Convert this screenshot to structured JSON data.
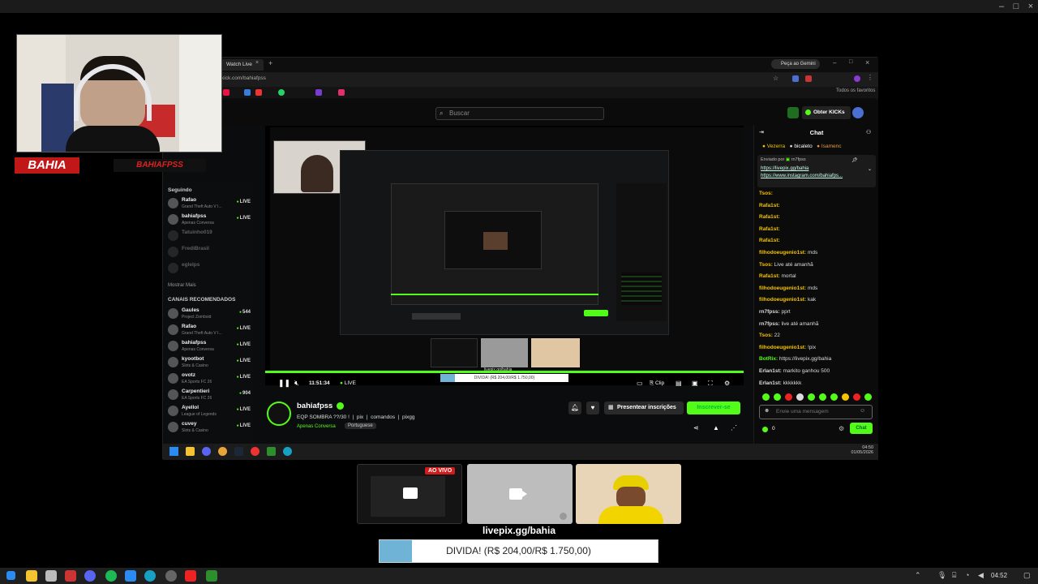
{
  "outer_window": {
    "controls": [
      "–",
      "□",
      "×"
    ]
  },
  "webcam": {
    "logo_text": "BAHIA",
    "brand_text": "BAHIAFPSS"
  },
  "browser": {
    "tab_label": "Watch Live",
    "gemini_label": "Peça ao Gemini",
    "url": "kick.com/bahiafpss",
    "bookmarks_label": "Todos os favoritos"
  },
  "kick": {
    "search_placeholder": "Buscar",
    "get_kicks": "Obter KICKs",
    "sidebar": {
      "following_header": "Seguindo",
      "following": [
        {
          "name": "Rafao",
          "sub": "Grand Theft Auto V I...",
          "status": "LIVE"
        },
        {
          "name": "bahiafpss",
          "sub": "Apenas Conversa",
          "status": "LIVE"
        },
        {
          "name": "Tatuinho019",
          "sub": "",
          "status": ""
        },
        {
          "name": "FrediBrasil",
          "sub": "",
          "status": ""
        },
        {
          "name": "eglelps",
          "sub": "",
          "status": ""
        }
      ],
      "show_more": "Mostrar Mais",
      "recommended_header": "CANAIS RECOMENDADOS",
      "recommended": [
        {
          "name": "Gaules",
          "sub": "Project Zomboid",
          "status": "544"
        },
        {
          "name": "Rafao",
          "sub": "Grand Theft Auto V I...",
          "status": "LIVE"
        },
        {
          "name": "bahiafpss",
          "sub": "Apenas Conversa",
          "status": "LIVE"
        },
        {
          "name": "kyootbot",
          "sub": "Slots & Casino",
          "status": "LIVE"
        },
        {
          "name": "ovotz",
          "sub": "EA Sports FC 26",
          "status": "LIVE"
        },
        {
          "name": "Carpentieri",
          "sub": "EA Sports FC 26",
          "status": "904"
        },
        {
          "name": "Ayellol",
          "sub": "League of Legends",
          "status": "LIVE"
        },
        {
          "name": "cuvey",
          "sub": "Slots & Casino",
          "status": "LIVE"
        }
      ]
    },
    "player": {
      "time": "11:51:34",
      "live": "LIVE",
      "clip": "Clip",
      "donation_small": "DIVIDA! (R$ 204,00/R$ 1.750,00)",
      "livepix_small": "livepix.gg/bahia"
    },
    "channel": {
      "name": "bahiafpss",
      "title_parts": [
        "EQP SOMBRA ??/30 !",
        "pix",
        "comandos",
        "pixgg"
      ],
      "category": "Apenas Conversa",
      "language": "Portuguese",
      "gift_button": "Presentear inscrições",
      "subscribe_button": "Inscrever-se"
    },
    "chat": {
      "title": "Chat",
      "top_gifters": [
        "Vezerra",
        "bicaleto",
        "Isamenc"
      ],
      "pinned_by": "Enviado por",
      "pinned_user": "rn7fpss",
      "pinned_lines": [
        "https://livepix.gg/bahia",
        "https://www.instagram.com/bahiafps..."
      ],
      "messages": [
        {
          "user": "Tsos:",
          "text": "",
          "color": "#f5c400"
        },
        {
          "user": "Rafa1st:",
          "text": "",
          "color": "#f5c400"
        },
        {
          "user": "Rafa1st:",
          "text": "",
          "color": "#f5c400"
        },
        {
          "user": "Rafa1st:",
          "text": "",
          "color": "#f5c400"
        },
        {
          "user": "Rafa1st:",
          "text": "",
          "color": "#f5c400"
        },
        {
          "user": "filhodoeugenio1st:",
          "text": "mds",
          "color": "#f5c400"
        },
        {
          "user": "Tsos:",
          "text": "Live até amanhã",
          "color": "#f5c400"
        },
        {
          "user": "Rafa1st:",
          "text": "mortal",
          "color": "#f5c400"
        },
        {
          "user": "filhodoeugenio1st:",
          "text": "mds",
          "color": "#f5c400"
        },
        {
          "user": "filhodoeugenio1st:",
          "text": "kak",
          "color": "#f5c400"
        },
        {
          "user": "rn7fpss:",
          "text": "pprt",
          "color": "#dddddd"
        },
        {
          "user": "rn7fpss:",
          "text": "live até amanhã",
          "color": "#dddddd"
        },
        {
          "user": "Tsos:",
          "text": "22",
          "color": "#f5c400"
        },
        {
          "user": "filhodoeugenio1st:",
          "text": "!pix",
          "color": "#f5c400"
        },
        {
          "user": "BotRix:",
          "text": "https://livepix.gg/bahia",
          "color": "#53fc18"
        },
        {
          "user": "Erlan1st:",
          "text": "markito ganhou 500",
          "color": "#dddddd"
        },
        {
          "user": "Erlan1st:",
          "text": "kkkkkkk",
          "color": "#dddddd"
        }
      ],
      "input_placeholder": "Envie uma mensagem",
      "count": "0",
      "send_button": "Chat"
    },
    "taskbar_inner": {
      "time": "04:50",
      "date": "01/05/2026"
    }
  },
  "overlay": {
    "live_badge": "AO VIVO",
    "livepix": "livepix.gg/bahia",
    "donation_text": "DIVIDA! (R$ 204,00/R$ 1.750,00)",
    "donation_progress": 0.1166
  },
  "taskbar": {
    "time": "04:52"
  },
  "colors": {
    "kick_green": "#53fc18",
    "donation_fill": "#6fb3d6"
  }
}
